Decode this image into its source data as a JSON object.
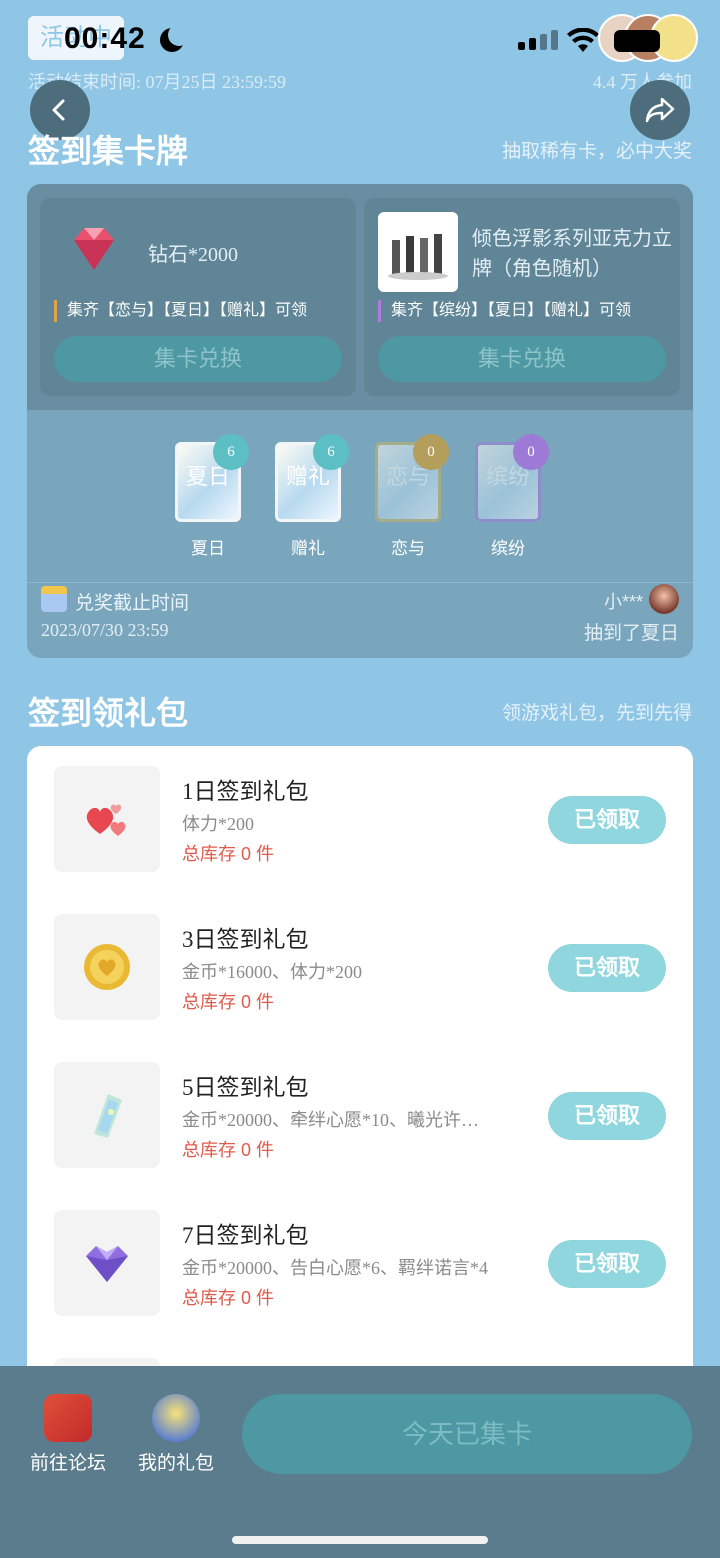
{
  "status": {
    "time": "00:42",
    "activity_tag": "活动中"
  },
  "header": {
    "end_time": "活动结束时间: 07月25日 23:59:59",
    "participants": "4.4 万人参加"
  },
  "collect_section": {
    "title": "签到集卡牌",
    "subtitle": "抽取稀有卡，必中大奖",
    "rewards": [
      {
        "name": "钻石*2000",
        "requirement": "集齐【恋与】【夏日】【赠礼】可领",
        "button": "集卡兑换",
        "icon": "diamond-icon"
      },
      {
        "name": "倾色浮影系列亚克力立牌（角色随机）",
        "requirement": "集齐【缤纷】【夏日】【赠礼】可领",
        "button": "集卡兑换",
        "icon": "acrylic-stand-photo"
      }
    ],
    "cards": [
      {
        "label": "夏日",
        "count": "6",
        "card_text": "夏日"
      },
      {
        "label": "赠礼",
        "count": "6",
        "card_text": "赠礼"
      },
      {
        "label": "恋与",
        "count": "0",
        "card_text": "恋与"
      },
      {
        "label": "缤纷",
        "count": "0",
        "card_text": "缤纷"
      }
    ],
    "deadline_label": "兑奖截止时间",
    "deadline_value": "2023/07/30 23:59",
    "recent_user": "小***",
    "recent_action": "抽到了夏日"
  },
  "gift_section": {
    "title": "签到领礼包",
    "subtitle": "领游戏礼包，先到先得",
    "gifts": [
      {
        "name": "1日签到礼包",
        "desc": "体力*200",
        "stock": "总库存 0 件",
        "button": "已领取",
        "icon": "hearts-icon"
      },
      {
        "name": "3日签到礼包",
        "desc": "金币*16000、体力*200",
        "stock": "总库存 0 件",
        "button": "已领取",
        "icon": "gold-coin-icon"
      },
      {
        "name": "5日签到礼包",
        "desc": "金币*20000、牵绊心愿*10、曦光许…",
        "stock": "总库存 0 件",
        "button": "已领取",
        "icon": "card-ticket-icon"
      },
      {
        "name": "7日签到礼包",
        "desc": "金币*20000、告白心愿*6、羁绊诺言*4",
        "stock": "总库存 0 件",
        "button": "已领取",
        "icon": "purple-heart-icon"
      }
    ]
  },
  "bottom_bar": {
    "forum": "前往论坛",
    "my_gifts": "我的礼包",
    "main_button": "今天已集卡"
  }
}
